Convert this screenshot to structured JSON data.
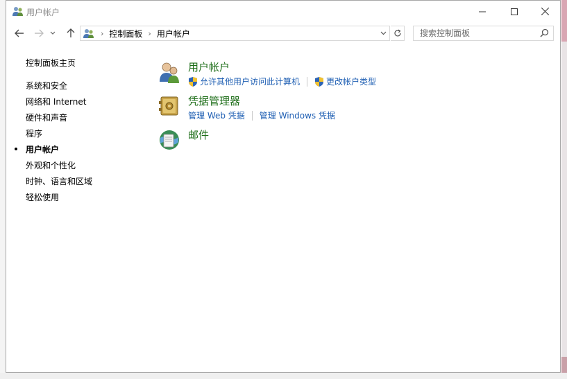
{
  "window": {
    "title": "用户帐户",
    "icon": "users-icon",
    "controls": [
      "minimize",
      "maximize",
      "close"
    ]
  },
  "navigation": {
    "back_icon": "arrow-left-icon",
    "forward_icon": "arrow-right-icon",
    "recent_icon": "chevron-down-icon",
    "up_icon": "arrow-up-icon",
    "breadcrumbs": [
      "控制面板",
      "用户帐户"
    ],
    "refresh_icon": "refresh-icon",
    "search_placeholder": "搜索控制面板"
  },
  "left_nav": {
    "home": "控制面板主页",
    "items": [
      {
        "label": "系统和安全",
        "current": false
      },
      {
        "label": "网络和 Internet",
        "current": false
      },
      {
        "label": "硬件和声音",
        "current": false
      },
      {
        "label": "程序",
        "current": false
      },
      {
        "label": "用户帐户",
        "current": true
      },
      {
        "label": "外观和个性化",
        "current": false
      },
      {
        "label": "时钟、语言和区域",
        "current": false
      },
      {
        "label": "轻松使用",
        "current": false
      }
    ]
  },
  "sections": [
    {
      "title": "用户帐户",
      "icon": "user-accounts-icon",
      "links": [
        {
          "label": "允许其他用户访问此计算机",
          "shield": true
        },
        {
          "label": "更改帐户类型",
          "shield": true
        }
      ]
    },
    {
      "title": "凭据管理器",
      "icon": "credential-manager-icon",
      "links": [
        {
          "label": "管理 Web 凭据",
          "shield": false
        },
        {
          "label": "管理 Windows 凭据",
          "shield": false
        }
      ]
    },
    {
      "title": "邮件",
      "icon": "mail-icon",
      "links": []
    }
  ],
  "colors": {
    "heading_green": "#1e6e19",
    "link_blue": "#1f5fb3"
  }
}
